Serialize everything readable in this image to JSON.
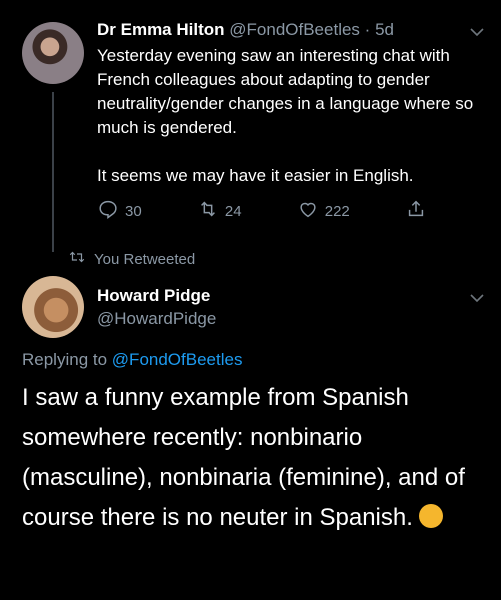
{
  "tweet1": {
    "display_name": "Dr Emma Hilton",
    "handle": "@FondOfBeetles",
    "separator": "·",
    "time": "5d",
    "text": "Yesterday evening saw an interesting chat with French colleagues about adapting to gender neutrality/gender changes in a language where so much is gendered.\n\nIt seems we may have it easier in English.",
    "replies": "30",
    "retweets": "24",
    "likes": "222"
  },
  "retweet_notice": "You Retweeted",
  "tweet2": {
    "display_name": "Howard Pidge",
    "handle": "@HowardPidge",
    "replying_prefix": "Replying to",
    "replying_handle": "@FondOfBeetles",
    "text": "I saw a funny example from Spanish somewhere recently: nonbinario (masculine), nonbinaria (feminine), and of course there is no neuter in Spanish."
  },
  "icons": {
    "reply": "reply-icon",
    "retweet": "retweet-icon",
    "like": "heart-icon",
    "share": "share-icon",
    "chevron": "chevron-down-icon",
    "emoji": "rolling-laughing-emoji-icon"
  },
  "colors": {
    "background": "#000000",
    "text": "#ffffff",
    "muted": "#8b98a5",
    "link": "#1d9bf0"
  }
}
